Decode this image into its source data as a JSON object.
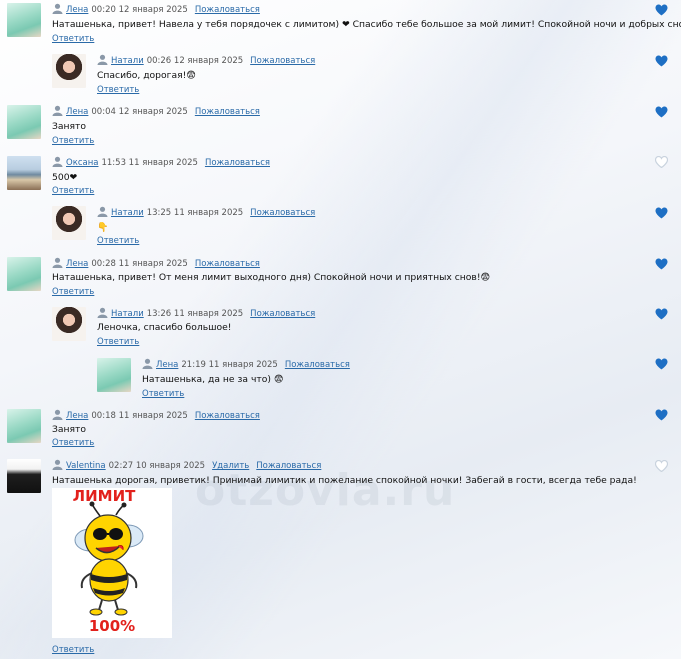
{
  "ui": {
    "reply_label": "Ответить",
    "complain_label": "Пожаловаться",
    "delete_label": "Удалить"
  },
  "watermark": "otzovia.ru",
  "comments": [
    {
      "author": "Лена",
      "time": "00:20 12 января 2025",
      "text": "Наташенька, привет! Навела у тебя порядочек с лимитом) ❤ Спасибо тебе большое за мой лимит! Спокойной ночи и добрых снов!😨",
      "liked": true
    },
    {
      "author": "Натали",
      "time": "00:26 12 января 2025",
      "text": "Спасибо, дорогая!😨",
      "liked": true
    },
    {
      "author": "Лена",
      "time": "00:04 12 января 2025",
      "text": "Занято",
      "liked": true
    },
    {
      "author": "Оксана",
      "time": "11:53 11 января 2025",
      "text": "500❤",
      "liked": false
    },
    {
      "author": "Натали",
      "time": "13:25 11 января 2025",
      "text": "👇",
      "liked": true
    },
    {
      "author": "Лена",
      "time": "00:28 11 января 2025",
      "text": "Наташенька, привет! От меня лимит выходного дня) Спокойной ночи и приятных снов!😨",
      "liked": true
    },
    {
      "author": "Натали",
      "time": "13:26 11 января 2025",
      "text": "Леночка, спасибо большое!",
      "liked": true
    },
    {
      "author": "Лена",
      "time": "21:19 11 января 2025",
      "text": "Наташенька, да не за что) 😨",
      "liked": true
    },
    {
      "author": "Лена",
      "time": "00:18 11 января 2025",
      "text": "Занято",
      "liked": true
    },
    {
      "author": "Valentina",
      "time": "02:27 10 января 2025",
      "text": "Наташенька дорогая, приветик! Принимай лимитик и пожелание спокойной ночки! Забегай в гости, всегда тебе рада!",
      "liked": false,
      "sticker": {
        "top_text": "ЛИМИТ",
        "bottom_text": "100%"
      }
    }
  ],
  "colors": {
    "link": "#2a6aa8",
    "heart_active": "#1e6fc4",
    "heart_inactive": "#c9d3de"
  }
}
